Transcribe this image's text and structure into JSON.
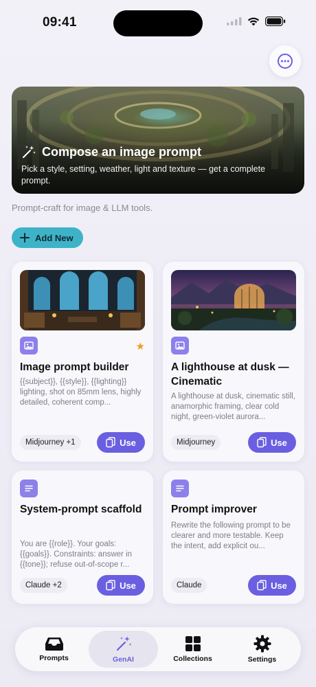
{
  "status": {
    "time": "09:41"
  },
  "hero": {
    "title": "Compose an image prompt",
    "description": "Pick a style, setting, weather, light and texture — get a complete prompt."
  },
  "subtitle": "Prompt-craft for image & LLM tools.",
  "add_new_label": "Add New",
  "cards": [
    {
      "title": "Image prompt builder",
      "description": "{{subject}}, {{style}}, {{lighting}} lighting, shot on 85mm lens, highly detailed, coherent comp...",
      "tag": "Midjourney +1",
      "use_label": "Use",
      "favorite": true,
      "icon": "image-icon"
    },
    {
      "title": "A lighthouse at dusk — Cinematic",
      "description": "A lighthouse at dusk, cinematic still, anamorphic framing, clear cold night, green-violet aurora...",
      "tag": "Midjourney",
      "use_label": "Use",
      "favorite": false,
      "icon": "image-icon"
    },
    {
      "title": "System-prompt scaffold",
      "description": "You are {{role}}. Your goals: {{goals}}. Constraints: answer in {{tone}}; refuse out-of-scope r...",
      "tag": "Claude +2",
      "use_label": "Use",
      "favorite": false,
      "icon": "text-lines-icon"
    },
    {
      "title": "Prompt improver",
      "description": "Rewrite the following prompt to be clearer and more testable. Keep the intent, add explicit ou...",
      "tag": "Claude",
      "use_label": "Use",
      "favorite": false,
      "icon": "text-lines-icon"
    }
  ],
  "tabs": [
    {
      "label": "Prompts",
      "icon": "tray-icon",
      "active": false
    },
    {
      "label": "GenAI",
      "icon": "magic-wand-icon",
      "active": true
    },
    {
      "label": "Collections",
      "icon": "grid-icon",
      "active": false
    },
    {
      "label": "Settings",
      "icon": "gear-icon",
      "active": false
    }
  ],
  "colors": {
    "accent": "#6a5fe0",
    "add_button": "#3eb3c8",
    "favorite_star": "#f29a1a",
    "type_icon": "#8d80ea"
  }
}
